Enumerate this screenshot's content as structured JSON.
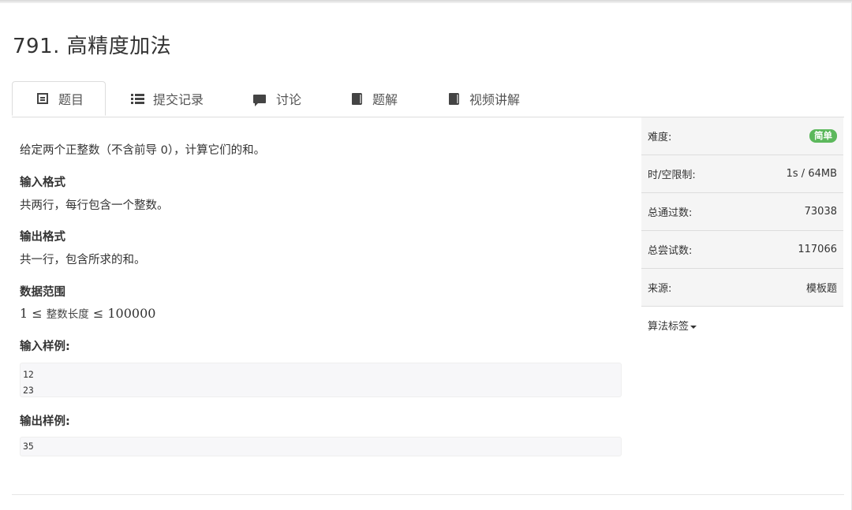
{
  "problem": {
    "title": "791. 高精度加法"
  },
  "tabs": [
    {
      "label": "题目",
      "icon": "document-icon"
    },
    {
      "label": "提交记录",
      "icon": "list-icon"
    },
    {
      "label": "讨论",
      "icon": "comment-icon"
    },
    {
      "label": "题解",
      "icon": "book-icon"
    },
    {
      "label": "视频讲解",
      "icon": "book-icon"
    }
  ],
  "content": {
    "description": "给定两个正整数（不含前导 0），计算它们的和。",
    "input_format_heading": "输入格式",
    "input_format_text": "共两行，每行包含一个整数。",
    "output_format_heading": "输出格式",
    "output_format_text": "共一行，包含所求的和。",
    "range_heading": "数据范围",
    "range_low": "1 ≤ ",
    "range_mid": "整数长度",
    "range_high": " ≤ 100000",
    "sample_input_heading": "输入样例:",
    "sample_input": "12\n23",
    "sample_output_heading": "输出样例:",
    "sample_output": "35"
  },
  "sidebar": {
    "difficulty_label": "难度:",
    "difficulty_value": "简单",
    "limit_label": "时/空限制:",
    "limit_value": "1s / 64MB",
    "accepted_label": "总通过数:",
    "accepted_value": "73038",
    "attempts_label": "总尝试数:",
    "attempts_value": "117066",
    "source_label": "来源:",
    "source_value": "模板题",
    "tags_label": "算法标签"
  },
  "colors": {
    "easy_badge": "#5cb85c",
    "border": "#dddddd",
    "sidebar_bg": "#f5f5f5"
  }
}
